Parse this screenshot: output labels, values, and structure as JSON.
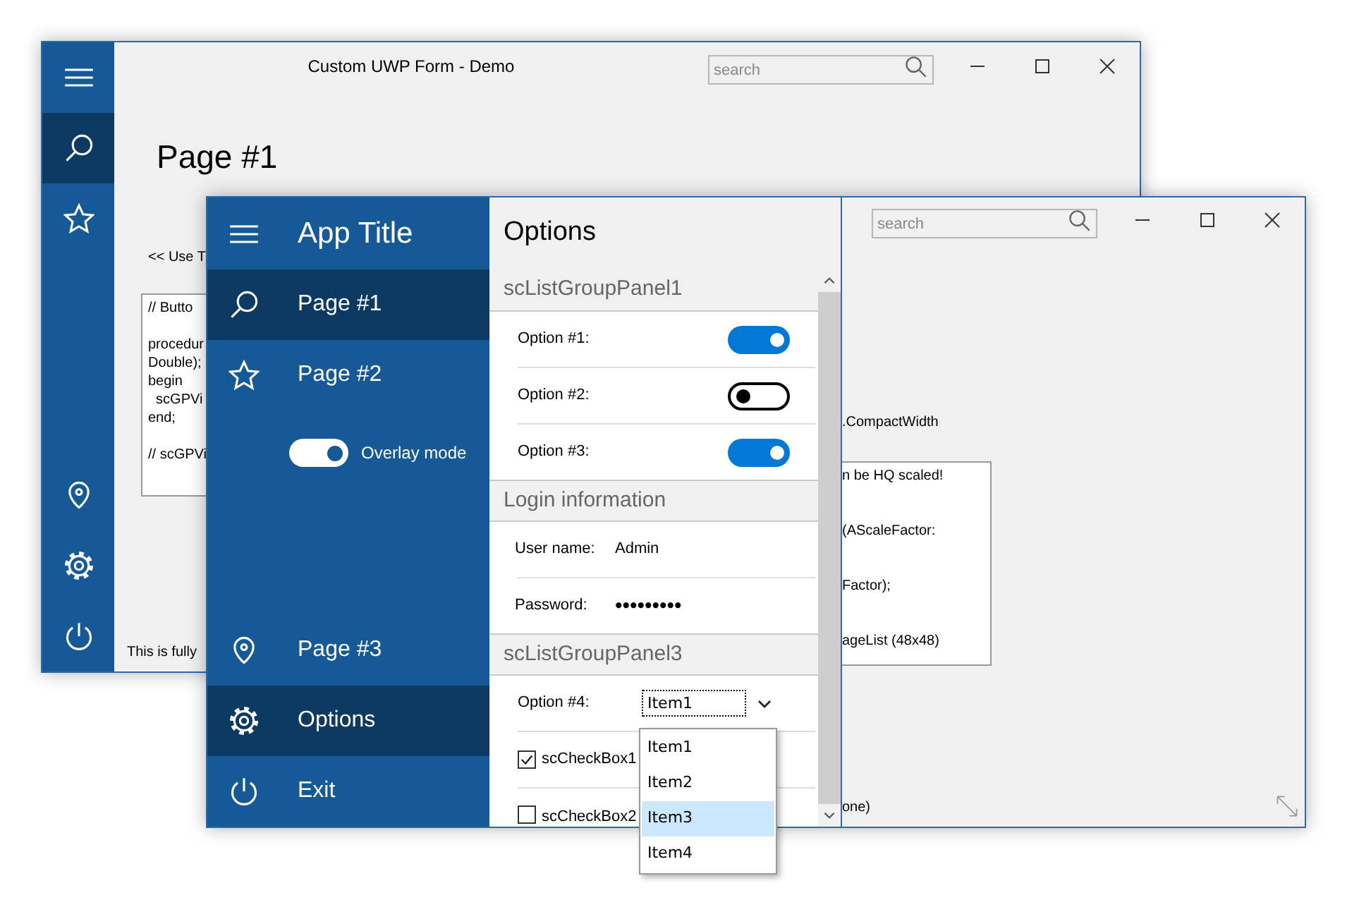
{
  "back_window": {
    "title": "Custom UWP Form - Demo",
    "search": {
      "placeholder": "search"
    },
    "rail": [
      {
        "selected": false
      },
      {
        "selected": true
      },
      {
        "selected": false
      },
      {
        "selected": false
      },
      {
        "selected": false
      },
      {
        "selected": false
      }
    ],
    "page_title": "Page #1",
    "hint": "<< Use T",
    "code_blocks": [
      [
        "// Butto"
      ],
      [
        "procedur",
        "Double);",
        "begin",
        "  scGPVi",
        "end;"
      ],
      [
        "// scGPVi"
      ]
    ],
    "footer": "This is fully"
  },
  "front_window": {
    "nav": {
      "title": "App Title",
      "top_items": [
        {
          "label": "Page #1",
          "selected": true
        },
        {
          "label": "Page #2",
          "selected": false
        }
      ],
      "overlay_toggle": {
        "label": "Overlay mode",
        "on": true
      },
      "bottom_items": [
        {
          "label": "Page #3",
          "selected": false
        },
        {
          "label": "Options",
          "selected": true
        },
        {
          "label": "Exit",
          "selected": false
        }
      ]
    },
    "options": {
      "title": "Options",
      "groups": [
        {
          "title": "scListGroupPanel1",
          "rows": [
            {
              "kind": "toggle",
              "label": "Option #1:",
              "on": true
            },
            {
              "kind": "toggle",
              "label": "Option #2:",
              "on": false
            },
            {
              "kind": "toggle",
              "label": "Option #3:",
              "on": true
            }
          ]
        },
        {
          "title": "Login information",
          "rows": [
            {
              "kind": "text",
              "label": "User name:",
              "value": "Admin"
            },
            {
              "kind": "password",
              "label": "Password:",
              "value": "•••••••••"
            }
          ]
        },
        {
          "title": "scListGroupPanel3",
          "rows": [
            {
              "kind": "combo",
              "label": "Option #4:",
              "value": "Item1",
              "expanded": true
            },
            {
              "kind": "checkbox",
              "label": "scCheckBox1",
              "checked": true
            },
            {
              "kind": "checkbox",
              "label": "scCheckBox2",
              "checked": false
            }
          ]
        }
      ]
    },
    "search": {
      "placeholder": "search"
    },
    "content": {
      "caption": ".CompactWidth",
      "box_lines": [
        "n be HQ scaled!",
        "(AScaleFactor:",
        "Factor);",
        "ageList (48x48)"
      ],
      "footer": "one)"
    }
  },
  "dropdown": {
    "items": [
      {
        "label": "Item1",
        "selected": false
      },
      {
        "label": "Item2",
        "selected": false
      },
      {
        "label": "Item3",
        "selected": true
      },
      {
        "label": "Item4",
        "selected": false
      }
    ]
  }
}
